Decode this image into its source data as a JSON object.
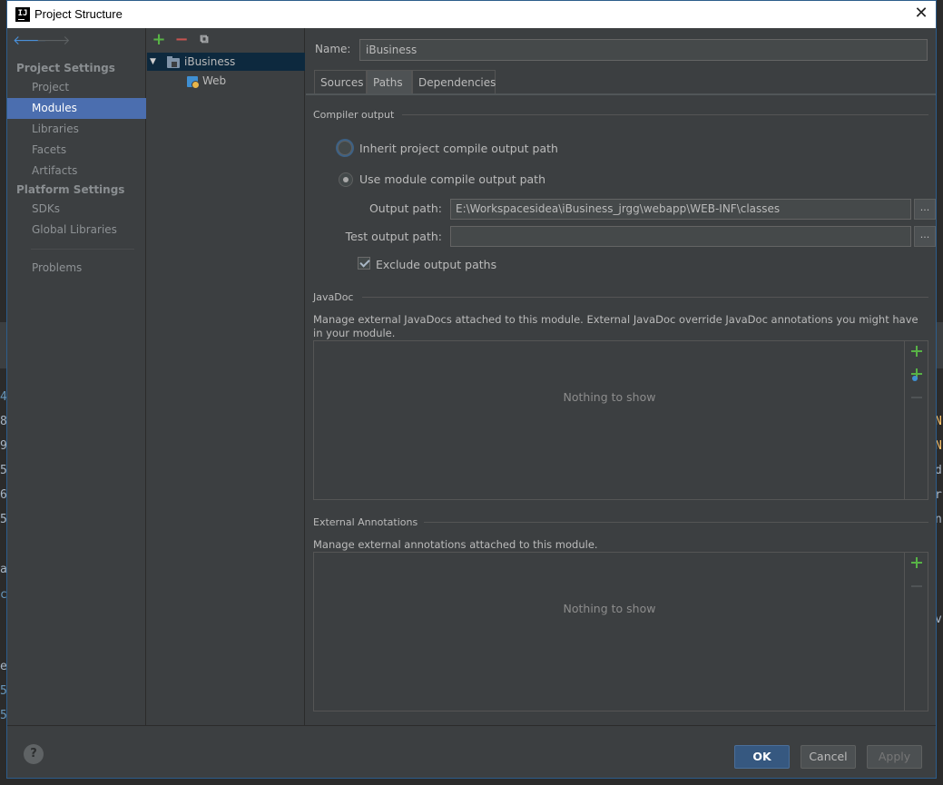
{
  "dialog": {
    "title": "Project Structure"
  },
  "nav": {
    "project_settings_header": "Project Settings",
    "platform_settings_header": "Platform Settings",
    "items": {
      "project": "Project",
      "modules": "Modules",
      "libraries": "Libraries",
      "facets": "Facets",
      "artifacts": "Artifacts",
      "sdks": "SDKs",
      "global_libraries": "Global Libraries",
      "problems": "Problems"
    }
  },
  "tree": {
    "module": "iBusiness",
    "facet": "Web"
  },
  "module": {
    "name_label": "Name:",
    "name_value": "iBusiness",
    "tabs": [
      "Sources",
      "Paths",
      "Dependencies"
    ],
    "active_tab": "Paths"
  },
  "compiler_output": {
    "title": "Compiler output",
    "inherit_label": "Inherit project compile output path",
    "use_module_label": "Use module compile output path",
    "output_path_label": "Output path:",
    "output_path_value": "E:\\Workspacesidea\\iBusiness_jrgg\\webapp\\WEB-INF\\classes",
    "test_output_path_label": "Test output path:",
    "test_output_path_value": "",
    "browse_label": "...",
    "exclude_label": "Exclude output paths",
    "exclude_checked": true
  },
  "javadoc": {
    "title": "JavaDoc",
    "description": "Manage external JavaDocs attached to this module. External JavaDoc override JavaDoc annotations you might have in your module.",
    "empty": "Nothing to show"
  },
  "annotations": {
    "title": "External Annotations",
    "description": "Manage external annotations attached to this module.",
    "empty": "Nothing to show"
  },
  "buttons": {
    "help": "?",
    "ok": "OK",
    "cancel": "Cancel",
    "apply": "Apply"
  },
  "colors": {
    "accent_selection": "#4b6eaf",
    "tree_selection": "#0d293e",
    "add_green": "#58b346"
  }
}
